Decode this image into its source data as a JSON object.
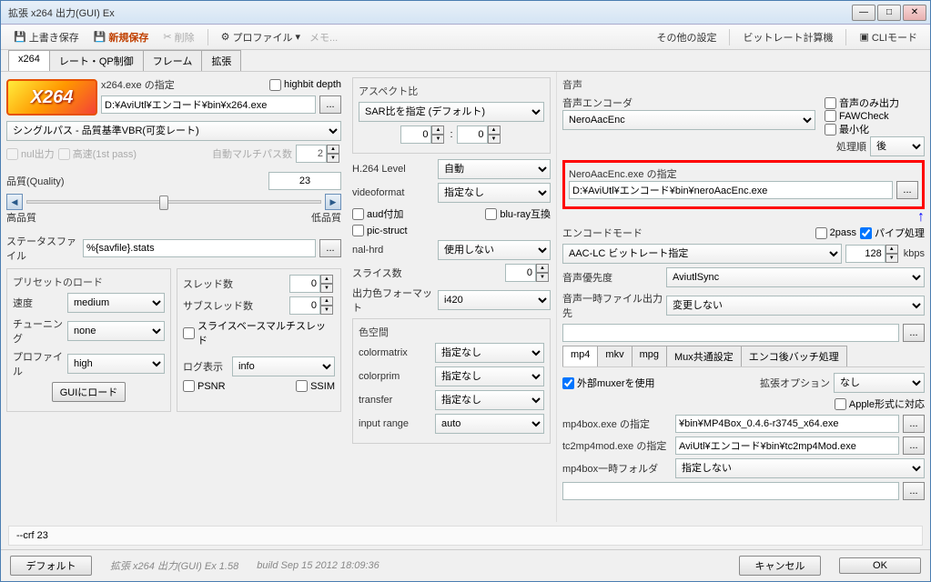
{
  "window": {
    "title": "拡張 x264 出力(GUI) Ex"
  },
  "toolbar": {
    "save": "上書き保存",
    "new": "新規保存",
    "delete": "削除",
    "profile": "プロファイル",
    "memo": "メモ...",
    "other": "その他の設定",
    "bitrate": "ビットレート計算機",
    "cli": "CLIモード"
  },
  "tabs": {
    "x264": "x264",
    "rate": "レート・QP制御",
    "frame": "フレーム",
    "ext": "拡張"
  },
  "x264": {
    "exe_label": "x264.exe の指定",
    "highbit": "highbit depth",
    "exe_path": "D:¥AviUtl¥エンコード¥bin¥x264.exe",
    "mode": "シングルパス - 品質基準VBR(可変レート)",
    "nul": "nul出力",
    "fast": "高速(1st pass)",
    "multipass_label": "自動マルチパス数",
    "multipass": "2",
    "quality_label": "品質(Quality)",
    "quality": "23",
    "hq": "高品質",
    "lq": "低品質",
    "stats_label": "ステータスファイル",
    "stats": "%{savfile}.stats"
  },
  "preset": {
    "title": "プリセットのロード",
    "speed_label": "速度",
    "speed": "medium",
    "tuning_label": "チューニング",
    "tuning": "none",
    "profile_label": "プロファイル",
    "profile": "high",
    "load": "GUIにロード"
  },
  "thread": {
    "threads_label": "スレッド数",
    "threads": "0",
    "sub_label": "サブスレッド数",
    "sub": "0",
    "slice": "スライスベースマルチスレッド",
    "log_label": "ログ表示",
    "log": "info",
    "psnr": "PSNR",
    "ssim": "SSIM"
  },
  "aspect": {
    "title": "アスペクト比",
    "mode": "SAR比を指定 (デフォルト)",
    "v1": "0",
    "v2": "0",
    "colon": ":"
  },
  "h264": {
    "level_label": "H.264 Level",
    "level": "自動",
    "vf_label": "videoformat",
    "vf": "指定なし",
    "aud": "aud付加",
    "bluray": "blu-ray互換",
    "pic": "pic-struct",
    "nal_label": "nal-hrd",
    "nal": "使用しない",
    "slice_label": "スライス数",
    "slice": "0",
    "outfmt_label": "出力色フォーマット",
    "outfmt": "i420"
  },
  "color": {
    "title": "色空間",
    "matrix_label": "colormatrix",
    "matrix": "指定なし",
    "prim_label": "colorprim",
    "prim": "指定なし",
    "transfer_label": "transfer",
    "transfer": "指定なし",
    "range_label": "input range",
    "range": "auto"
  },
  "audio": {
    "title": "音声",
    "encoder_label": "音声エンコーダ",
    "encoder": "NeroAacEnc",
    "only": "音声のみ出力",
    "faw": "FAWCheck",
    "mini": "最小化",
    "order_label": "処理順",
    "order": "後",
    "exe_label": "NeroAacEnc.exe の指定",
    "exe_path": "D:¥AviUtl¥エンコード¥bin¥neroAacEnc.exe",
    "mode_label": "エンコードモード",
    "twopass": "2pass",
    "pipe": "パイプ処理",
    "mode": "AAC-LC ビットレート指定",
    "bitrate": "128",
    "kbps": "kbps",
    "priority_label": "音声優先度",
    "priority": "AviutlSync",
    "tmp_label": "音声一時ファイル出力先",
    "tmp": "変更しない"
  },
  "mux": {
    "tabs": {
      "mp4": "mp4",
      "mkv": "mkv",
      "mpg": "mpg",
      "common": "Mux共通設定",
      "batch": "エンコ後バッチ処理"
    },
    "ext_muxer": "外部muxerを使用",
    "ext_opt_label": "拡張オプション",
    "ext_opt": "なし",
    "apple": "Apple形式に対応",
    "mp4box_label": "mp4box.exe の指定",
    "mp4box": "¥bin¥MP4Box_0.4.6-r3745_x64.exe",
    "tc2mp4_label": "tc2mp4mod.exe の指定",
    "tc2mp4": "AviUtl¥エンコード¥bin¥tc2mp4Mod.exe",
    "tmp_label": "mp4box一時フォルダ",
    "tmp": "指定しない"
  },
  "cmd": "--crf 23",
  "footer": {
    "default": "デフォルト",
    "version": "拡張 x264 出力(GUI) Ex 1.58",
    "build": "build Sep 15 2012 18:09:36",
    "cancel": "キャンセル",
    "ok": "OK"
  }
}
